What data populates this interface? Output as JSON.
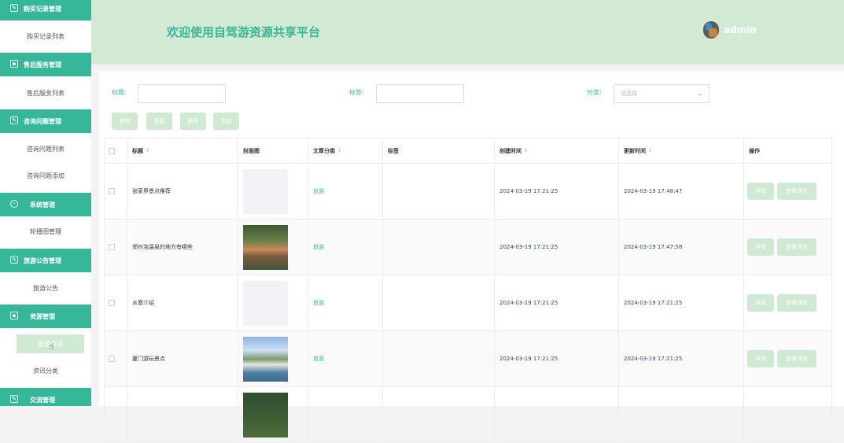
{
  "sidebar": {
    "groups": [
      {
        "label": "购买记录管理",
        "icon": "edit-icon"
      },
      {
        "label": "售后服务管理",
        "icon": "box-icon"
      },
      {
        "label": "咨询问题管理",
        "icon": "edit-icon"
      },
      {
        "label": "系统管理",
        "icon": "gear-icon"
      },
      {
        "label": "旅游公告管理",
        "icon": "edit-icon"
      },
      {
        "label": "资源管理",
        "icon": "box-icon"
      },
      {
        "label": "交流管理",
        "icon": "edit-icon"
      }
    ],
    "items": [
      {
        "label": "购买记录列表"
      },
      {
        "label": "售后服务列表"
      },
      {
        "label": "咨询问题列表"
      },
      {
        "label": "咨询问题添加"
      },
      {
        "label": "轮播图管理"
      },
      {
        "label": "旅游公告"
      },
      {
        "label": "旅游资讯"
      },
      {
        "label": "资讯分类"
      }
    ]
  },
  "header": {
    "title": "欢迎使用自驾游资源共享平台",
    "username": "admin"
  },
  "filters": {
    "title_label": "标题:",
    "tag_label": "标签:",
    "category_label": "分类:",
    "category_placeholder": "请选择"
  },
  "actions": {
    "query": "查询",
    "reset": "重置",
    "delete": "删除",
    "add": "添加"
  },
  "table": {
    "columns": {
      "title": "标题",
      "cover": "封面图",
      "category": "文章分类",
      "tags": "标签",
      "created": "创建时间",
      "updated": "更新时间",
      "ops": "操作"
    },
    "rows": [
      {
        "title": "张家界景点推荐",
        "cover": "empty",
        "category": "旅游",
        "created": "2024-03-19 17:21:25",
        "updated": "2024-03-19 17:48:47"
      },
      {
        "title": "郑州泡温泉的地方有哪些",
        "cover": "img1",
        "category": "旅游",
        "created": "2024-03-19 17:21:25",
        "updated": "2024-03-19 17:47:58"
      },
      {
        "title": "水寨介绍",
        "cover": "empty",
        "category": "旅游",
        "created": "2024-03-19 17:21:25",
        "updated": "2024-03-19 17:21:25"
      },
      {
        "title": "厦门游玩景点",
        "cover": "img2",
        "category": "旅游",
        "created": "2024-03-19 17:21:25",
        "updated": "2024-03-19 17:21:25"
      }
    ],
    "detail_label": "详情",
    "review_label": "查看评论"
  }
}
